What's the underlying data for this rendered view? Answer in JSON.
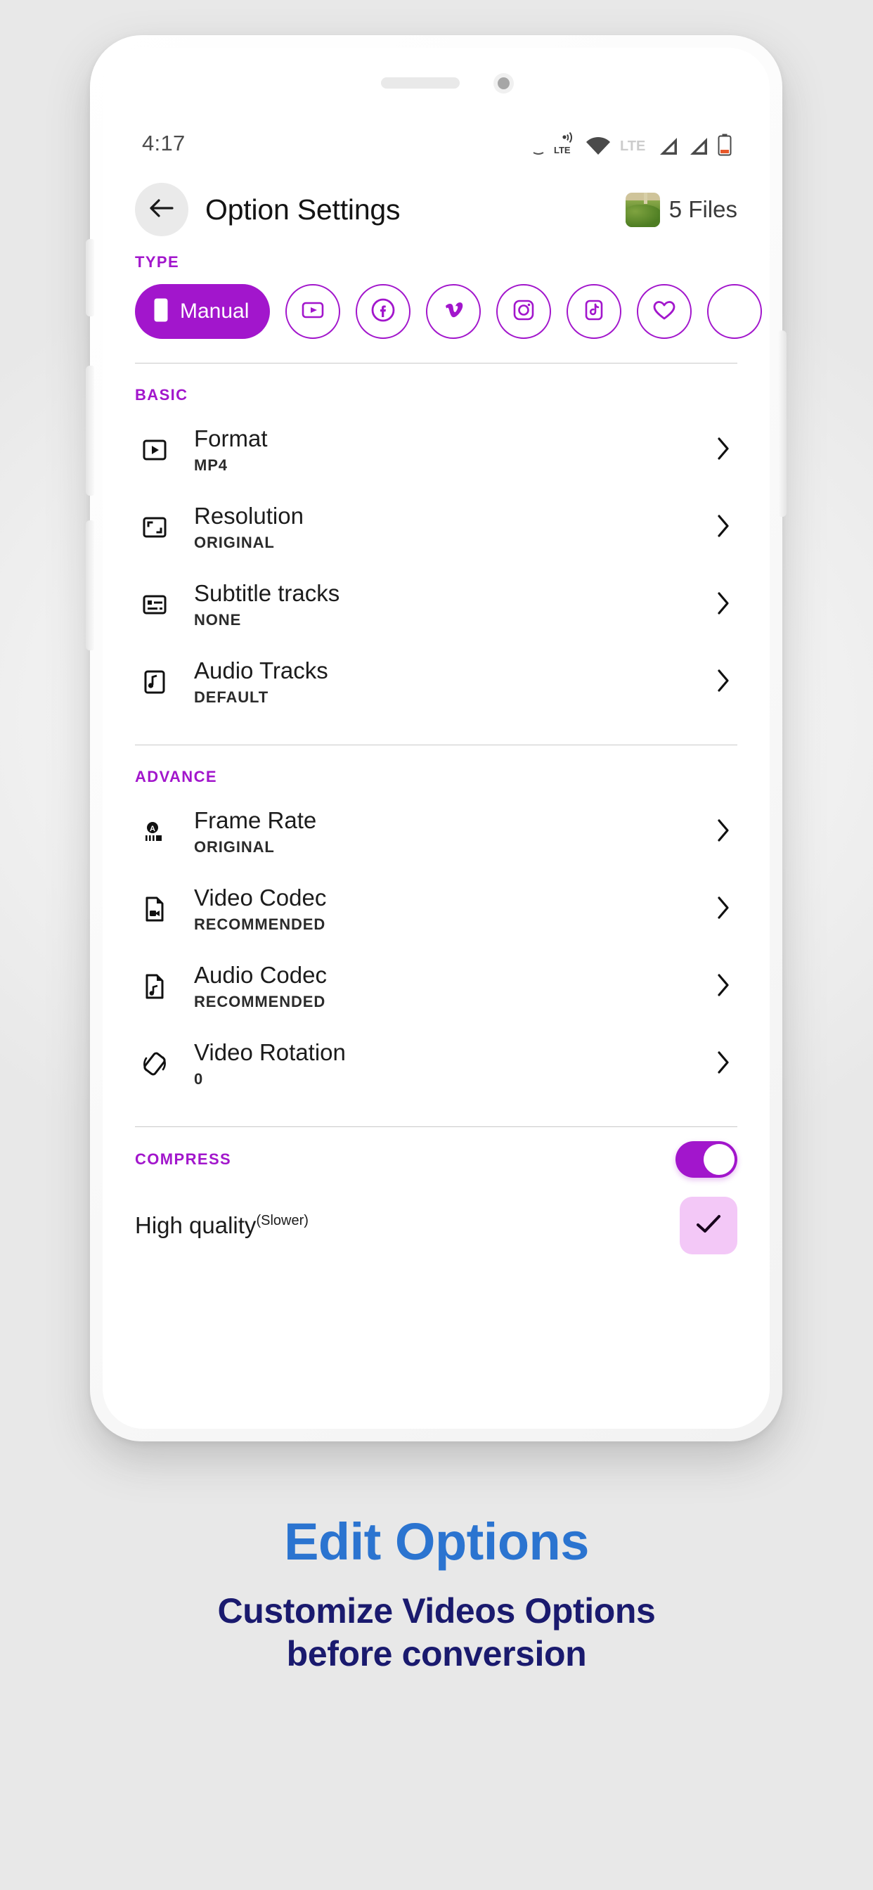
{
  "status_bar": {
    "time": "4:17",
    "icons": [
      "lte-data-icon",
      "wifi-icon",
      "lte-label-icon",
      "signal-bars-icon",
      "signal-bars-2-icon",
      "battery-icon"
    ],
    "lte_label": "LTE",
    "lte_small_label": "LTE"
  },
  "header": {
    "back_icon": "back-arrow-icon",
    "title": "Option Settings",
    "thumbnail": "video-thumbnail",
    "file_count": "5 Files"
  },
  "type_section": {
    "label": "TYPE",
    "chips": [
      {
        "id": "manual",
        "label": "Manual",
        "icon": "phone-icon",
        "selected": true
      },
      {
        "id": "youtube",
        "label": "",
        "icon": "youtube-icon",
        "selected": false
      },
      {
        "id": "facebook",
        "label": "",
        "icon": "facebook-icon",
        "selected": false
      },
      {
        "id": "vimeo",
        "label": "",
        "icon": "vimeo-icon",
        "selected": false
      },
      {
        "id": "instagram",
        "label": "",
        "icon": "instagram-icon",
        "selected": false
      },
      {
        "id": "tiktok",
        "label": "",
        "icon": "tiktok-icon",
        "selected": false
      },
      {
        "id": "favorite",
        "label": "",
        "icon": "heart-icon",
        "selected": false
      },
      {
        "id": "more",
        "label": "",
        "icon": "more-icon",
        "selected": false
      }
    ]
  },
  "basic_section": {
    "label": "BASIC",
    "rows": [
      {
        "icon": "format-play-icon",
        "title": "Format",
        "value": "MP4",
        "chevron": "chevron-right-icon"
      },
      {
        "icon": "resolution-icon",
        "title": "Resolution",
        "value": "ORIGINAL",
        "chevron": "chevron-right-icon"
      },
      {
        "icon": "subtitle-icon",
        "title": "Subtitle tracks",
        "value": "NONE",
        "chevron": "chevron-right-icon"
      },
      {
        "icon": "audio-track-icon",
        "title": "Audio Tracks",
        "value": "DEFAULT",
        "chevron": "chevron-right-icon"
      }
    ]
  },
  "advance_section": {
    "label": "ADVANCE",
    "rows": [
      {
        "icon": "frame-rate-icon",
        "title": "Frame Rate",
        "value": "ORIGINAL",
        "chevron": "chevron-right-icon"
      },
      {
        "icon": "video-codec-icon",
        "title": "Video Codec",
        "value": "RECOMMENDED",
        "chevron": "chevron-right-icon"
      },
      {
        "icon": "audio-codec-icon",
        "title": "Audio Codec",
        "value": "RECOMMENDED",
        "chevron": "chevron-right-icon"
      },
      {
        "icon": "video-rotation-icon",
        "title": "Video Rotation",
        "value": "0",
        "chevron": "chevron-right-icon"
      }
    ]
  },
  "compress_section": {
    "label": "COMPRESS",
    "toggle_on": true,
    "quality_label": "High quality",
    "quality_note": "(Slower)",
    "quality_checked": true
  },
  "promo": {
    "title": "Edit Options",
    "subtitle_line1": "Customize Videos Options",
    "subtitle_line2": "before conversion"
  },
  "colors": {
    "accent_purple": "#a216cc",
    "promo_blue": "#2b74d0",
    "promo_navy": "#1a1a6e",
    "checkbox_pink": "#f3c8f7"
  }
}
